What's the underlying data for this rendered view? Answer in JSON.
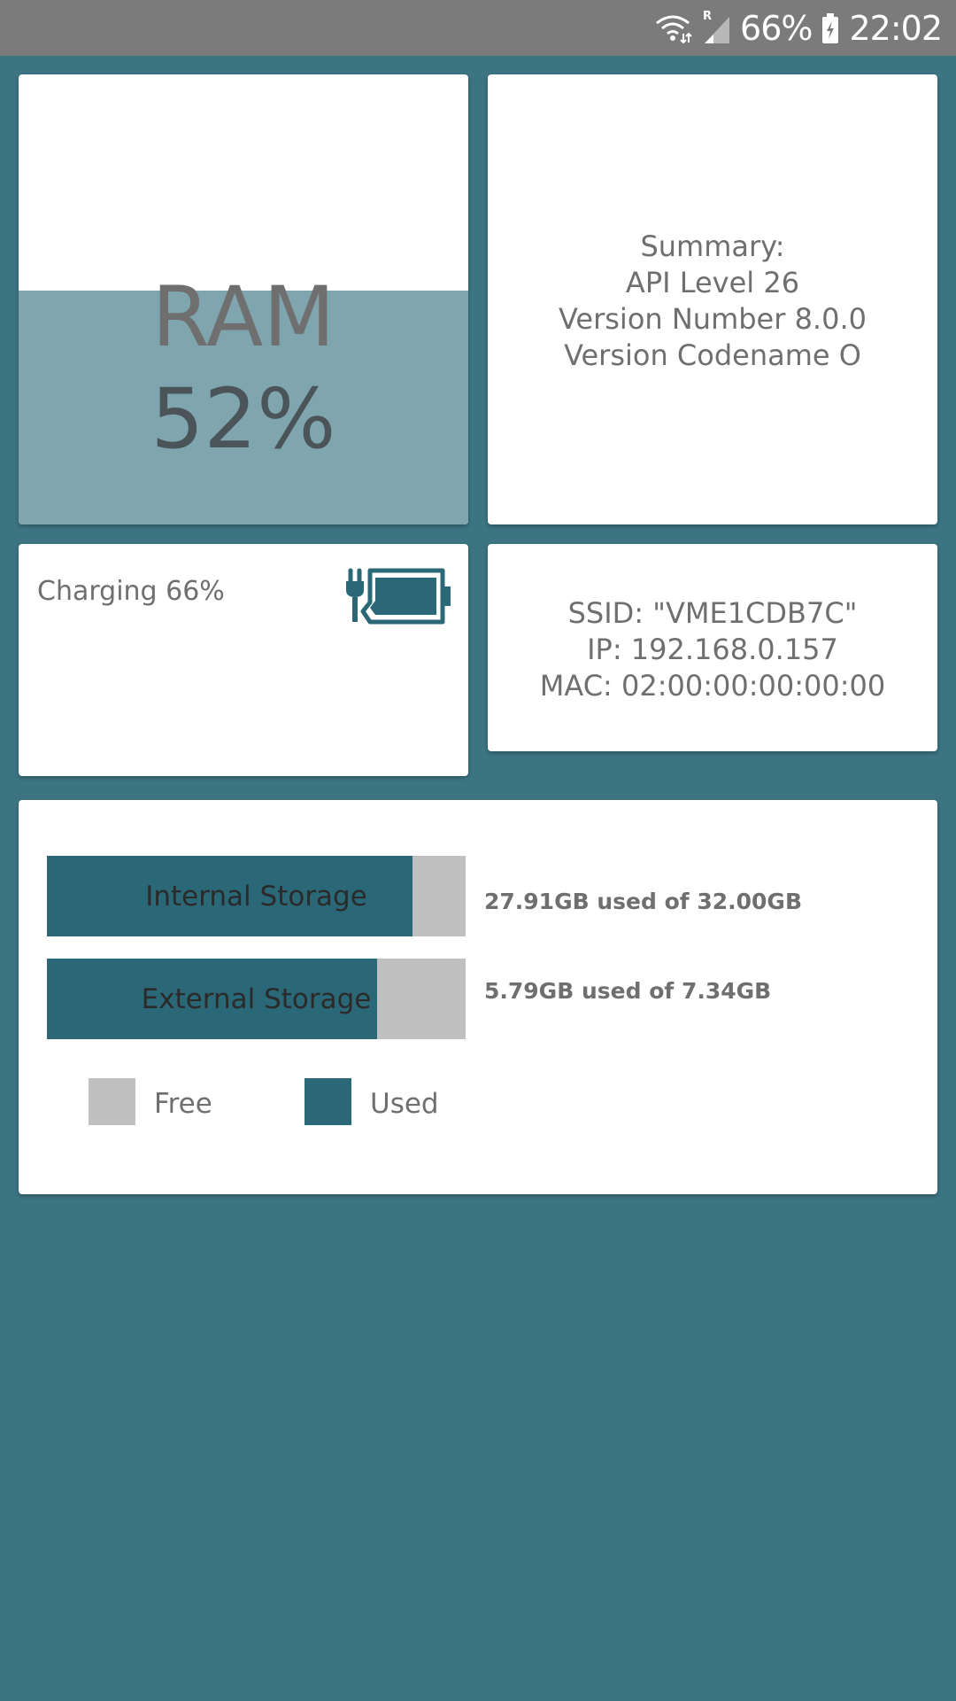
{
  "status_bar": {
    "signal_roaming": "R",
    "battery_percent": "66%",
    "time": "22:02"
  },
  "ram": {
    "title": "RAM",
    "percent_label": "52%",
    "usage_fraction": 0.52
  },
  "summary": {
    "lines": [
      "Summary:",
      "API Level 26",
      "Version Number 8.0.0",
      "Version Codename O"
    ]
  },
  "battery": {
    "label": "Charging 66%",
    "icon": "battery-charging-icon"
  },
  "network": {
    "lines": [
      "SSID: \"VME1CDB7C\"",
      "IP: 192.168.0.157",
      "MAC: 02:00:00:00:00:00"
    ]
  },
  "storage": {
    "internal": {
      "label": "Internal Storage",
      "info": "27.91GB used of 32.00GB",
      "used_gb": 27.91,
      "total_gb": 32.0
    },
    "external": {
      "label": "External Storage",
      "info": "5.79GB used of 7.34GB",
      "used_gb": 5.79,
      "total_gb": 7.34
    },
    "legend": {
      "free_label": "Free",
      "used_label": "Used"
    }
  },
  "colors": {
    "background": "#3c7482",
    "accent": "#2a6878",
    "free": "#c0c0c0",
    "ram_fill": "#7fa5ae",
    "status_bar": "#7b7b7b"
  }
}
